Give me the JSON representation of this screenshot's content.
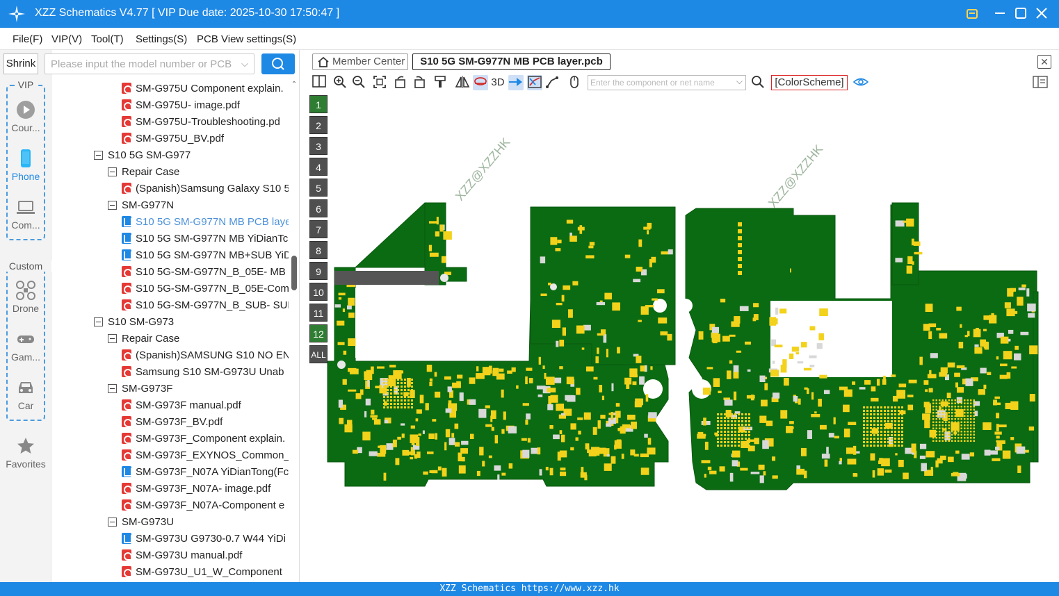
{
  "window": {
    "title": "XZZ Schematics V4.77 [ VIP Due date: 2025-10-30 17:50:47 ]",
    "accent_color": "#1e88e5",
    "controls": [
      "cart-icon",
      "minimize-icon",
      "maximize-icon",
      "close-icon"
    ]
  },
  "menu": {
    "items": [
      "File(F)",
      "VIP(V)",
      "Tool(T)",
      "Settings(S)",
      "PCB View settings(S)"
    ]
  },
  "sidebar": {
    "shrink_label": "Shrink",
    "vip_label": "VIP",
    "custom_label": "Custom",
    "items": [
      {
        "label": "Cour...",
        "icon": "play-icon"
      },
      {
        "label": "Phone",
        "icon": "phone-icon"
      },
      {
        "label": "Com...",
        "icon": "laptop-icon"
      },
      {
        "label": "Drone",
        "icon": "drone-icon"
      },
      {
        "label": "Gam...",
        "icon": "gamepad-icon"
      },
      {
        "label": "Car",
        "icon": "car-icon"
      },
      {
        "label": "Favorites",
        "icon": "star-icon"
      }
    ]
  },
  "search": {
    "placeholder": "Please input the model number or PCB"
  },
  "tree": {
    "rows": [
      {
        "label": "SM-G975U Component explain.",
        "type": "pdf",
        "level": 2
      },
      {
        "label": "SM-G975U- image.pdf",
        "type": "pdf",
        "level": 2
      },
      {
        "label": "SM-G975U-Troubleshooting.pd",
        "type": "pdf",
        "level": 2
      },
      {
        "label": "SM-G975U_BV.pdf",
        "type": "pdf",
        "level": 2
      },
      {
        "label": "S10 5G SM-G977",
        "type": "folder",
        "level": 0
      },
      {
        "label": "Repair Case",
        "type": "folder",
        "level": 1
      },
      {
        "label": "(Spanish)Samsung Galaxy S10 5",
        "type": "pdf",
        "level": 2
      },
      {
        "label": "SM-G977N",
        "type": "folder",
        "level": 1
      },
      {
        "label": "S10 5G SM-G977N MB PCB laye",
        "type": "pcb",
        "level": 2,
        "selected": true
      },
      {
        "label": "S10 5G SM-G977N MB YiDianTc",
        "type": "pcb",
        "level": 2
      },
      {
        "label": "S10 5G SM-G977N MB+SUB YiD",
        "type": "pcb",
        "level": 2
      },
      {
        "label": "S10 5G-SM-G977N_B_05E- MB i",
        "type": "pdf",
        "level": 2
      },
      {
        "label": "S10 5G-SM-G977N_B_05E-Comp",
        "type": "pdf",
        "level": 2
      },
      {
        "label": "S10 5G-SM-G977N_B_SUB- SUB",
        "type": "pdf",
        "level": 2
      },
      {
        "label": "S10 SM-G973",
        "type": "folder",
        "level": 0
      },
      {
        "label": "Repair Case",
        "type": "folder",
        "level": 1
      },
      {
        "label": "(Spanish)SAMSUNG S10 NO EN",
        "type": "pdf",
        "level": 2
      },
      {
        "label": "Samsung S10 SM-G973U  Unab",
        "type": "pdf",
        "level": 2
      },
      {
        "label": "SM-G973F",
        "type": "folder",
        "level": 1
      },
      {
        "label": "SM-G973F manual.pdf",
        "type": "pdf",
        "level": 2
      },
      {
        "label": "SM-G973F_BV.pdf",
        "type": "pdf",
        "level": 2
      },
      {
        "label": "SM-G973F_Component explain.",
        "type": "pdf",
        "level": 2
      },
      {
        "label": "SM-G973F_EXYNOS_Common_S",
        "type": "pdf",
        "level": 2
      },
      {
        "label": "SM-G973F_N07A YiDianTong(Fc",
        "type": "pcb",
        "level": 2
      },
      {
        "label": "SM-G973F_N07A- image.pdf",
        "type": "pdf",
        "level": 2
      },
      {
        "label": "SM-G973F_N07A-Component e",
        "type": "pdf",
        "level": 2
      },
      {
        "label": "SM-G973U",
        "type": "folder",
        "level": 1
      },
      {
        "label": "SM-G973U G9730-0.7 W44 YiDi",
        "type": "pcb",
        "level": 2
      },
      {
        "label": "SM-G973U manual.pdf",
        "type": "pdf",
        "level": 2
      },
      {
        "label": "SM-G973U_U1_W_Component",
        "type": "pdf",
        "level": 2
      }
    ]
  },
  "tabs": {
    "home_label": "Member Center",
    "active_label": "S10 5G SM-G977N MB PCB layer.pcb"
  },
  "toolbar": {
    "three_d_label": "3D",
    "component_search_placeholder": "Enter the component or net name",
    "color_scheme_label": "[ColorScheme]"
  },
  "layers": [
    "1",
    "2",
    "3",
    "4",
    "5",
    "6",
    "7",
    "8",
    "9",
    "10",
    "11",
    "12",
    "ALL"
  ],
  "pcb": {
    "watermark": "XZZ@XZZHK",
    "board_color": "#0b6b12",
    "pad_color": "#f2d21b"
  },
  "status": {
    "text": "XZZ Schematics https://www.xzz.hk"
  }
}
